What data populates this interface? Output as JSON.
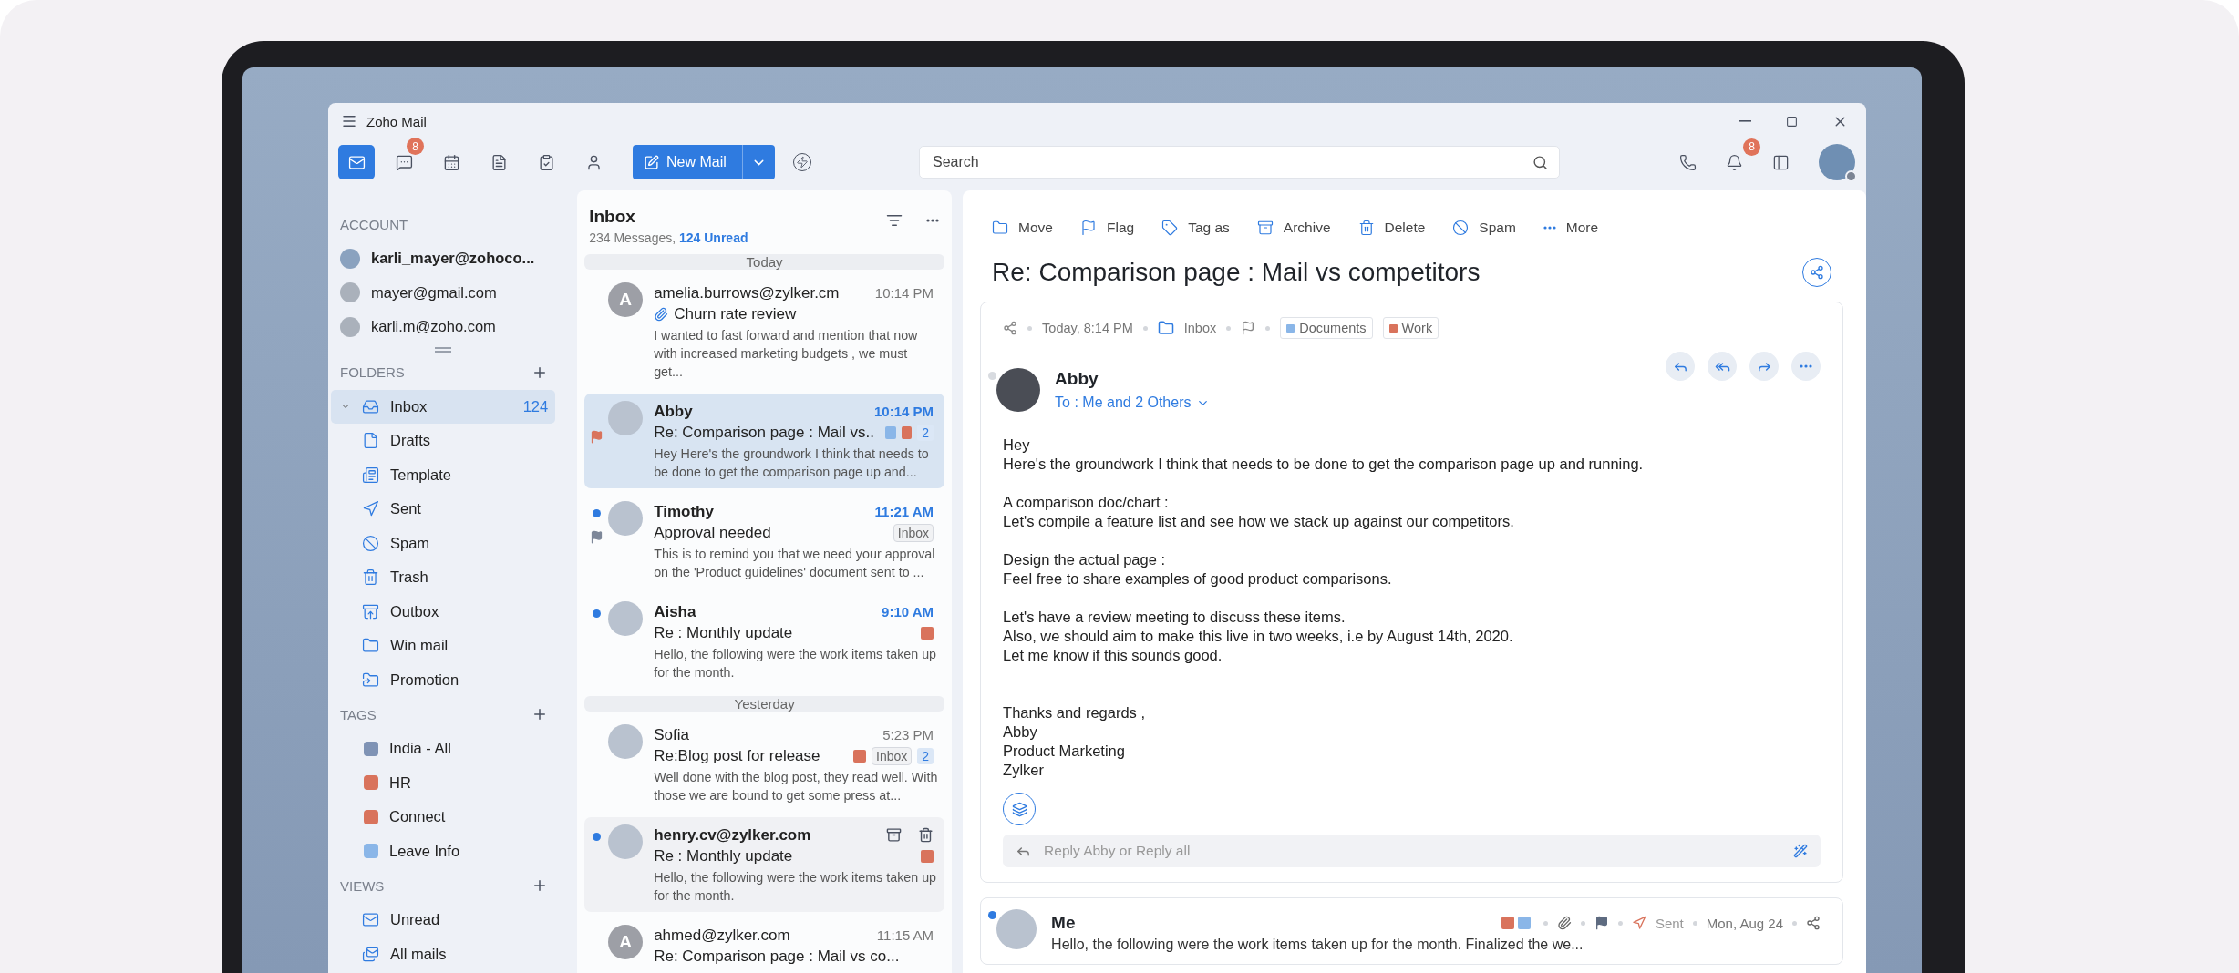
{
  "window": {
    "title": "Zoho Mail"
  },
  "toolbar": {
    "apps": [
      {
        "selected": true
      },
      {
        "selected": false,
        "badge": "8"
      },
      {
        "selected": false
      },
      {
        "selected": false
      },
      {
        "selected": false
      },
      {
        "selected": false
      }
    ],
    "new_mail": "New Mail",
    "search": {
      "placeholder": "Search"
    },
    "notifications_badge": "8"
  },
  "sidebar": {
    "account": {
      "heading": "ACCOUNT",
      "items": [
        {
          "label": "karli_mayer@zohoco...",
          "selected": true
        },
        {
          "label": "mayer@gmail.com",
          "selected": false
        },
        {
          "label": "karli.m@zoho.com",
          "selected": false
        }
      ]
    },
    "folders": {
      "heading": "FOLDERS",
      "items": [
        {
          "label": "Inbox",
          "count": "124",
          "selected": true,
          "collapsible": true
        },
        {
          "label": "Drafts",
          "selected": false,
          "collapsible": false
        },
        {
          "label": "Template",
          "selected": false,
          "collapsible": false
        },
        {
          "label": "Sent",
          "selected": false,
          "collapsible": false
        },
        {
          "label": "Spam",
          "selected": false,
          "collapsible": false
        },
        {
          "label": "Trash",
          "selected": false,
          "collapsible": false
        },
        {
          "label": "Outbox",
          "selected": false,
          "collapsible": false
        },
        {
          "label": "Win mail",
          "selected": false,
          "collapsible": false
        },
        {
          "label": "Promotion",
          "selected": false,
          "collapsible": false
        }
      ]
    },
    "tags": {
      "heading": "TAGS",
      "items": [
        {
          "label": "India - All",
          "color": "#7f93b5"
        },
        {
          "label": "HR",
          "color": "#d9735c"
        },
        {
          "label": "Connect",
          "color": "#d9735c"
        },
        {
          "label": "Leave Info",
          "color": "#8ab6e8"
        }
      ]
    },
    "views": {
      "heading": "VIEWS",
      "items": [
        {
          "label": "Unread"
        },
        {
          "label": "All mails"
        }
      ]
    }
  },
  "list": {
    "title": "Inbox",
    "count_text": "234 Messages,",
    "unread_text": "124 Unread",
    "groups": [
      {
        "heading": "Today",
        "messages": [
          {
            "sender": "amelia.burrows@zylker.cm",
            "time": "10:14 PM",
            "subject": "Churn rate review",
            "preview": "I wanted to fast forward and mention that now with increased marketing budgets , we must get...",
            "avatar": {
              "kind": "letter",
              "letter": "A"
            },
            "unread": false,
            "selected": false,
            "hovered": false,
            "attachment": true
          },
          {
            "sender": "Abby",
            "time": "10:14 PM",
            "subject": "Re: Comparison page : Mail vs..",
            "preview": "Hey  Here's the groundwork I think  that needs to be done to get the comparison page up and...",
            "avatar": {
              "kind": "photo"
            },
            "unread": false,
            "selected": true,
            "hovered": false,
            "attachment": false,
            "flag": {
              "color": "#d9735c"
            },
            "tags": [
              {
                "color": "#8ab6e8"
              },
              {
                "color": "#d9735c"
              }
            ],
            "thread_count": "2"
          },
          {
            "sender": "Timothy",
            "time": "11:21 AM",
            "subject": "Approval needed",
            "preview": "This is to remind you that we need your approval on the 'Product guidelines' document sent to ...",
            "avatar": {
              "kind": "photo"
            },
            "unread": true,
            "selected": false,
            "hovered": false,
            "attachment": false,
            "flag": {
              "color": "#7d8799"
            },
            "folder_badge": "Inbox"
          },
          {
            "sender": "Aisha",
            "time": "9:10 AM",
            "subject": "Re : Monthly update",
            "preview": "Hello, the following were the work items taken up for the month.",
            "avatar": {
              "kind": "photo"
            },
            "unread": true,
            "selected": false,
            "hovered": false,
            "attachment": false,
            "tags": [
              {
                "color": "#d9735c"
              }
            ]
          }
        ]
      },
      {
        "heading": "Yesterday",
        "messages": [
          {
            "sender": "Sofia",
            "time": "5:23 PM",
            "subject": "Re:Blog post for release",
            "preview": "Well done with the blog post, they read well. With those we are bound to get some press at...",
            "avatar": {
              "kind": "photo"
            },
            "unread": false,
            "selected": false,
            "hovered": false,
            "attachment": false,
            "tags": [
              {
                "color": "#d9735c"
              }
            ],
            "folder_badge": "Inbox",
            "thread_count": "2"
          },
          {
            "sender": "henry.cv@zylker.com",
            "subject": "Re : Monthly update",
            "preview": "Hello, the following were the work items taken up for the month.",
            "avatar": {
              "kind": "photo"
            },
            "unread": true,
            "selected": false,
            "hovered": true,
            "attachment": false,
            "tags": [
              {
                "color": "#d9735c"
              }
            ]
          },
          {
            "sender": "ahmed@zylker.com",
            "time": "11:15 AM",
            "subject": "Re: Comparison page : Mail vs co...",
            "avatar": {
              "kind": "letter",
              "letter": "A"
            },
            "unread": false,
            "selected": false,
            "hovered": false,
            "attachment": false
          }
        ]
      }
    ]
  },
  "reader": {
    "actions": [
      "Move",
      "Flag",
      "Tag as",
      "Archive",
      "Delete",
      "Spam",
      "More"
    ],
    "subject": "Re: Comparison page : Mail vs competitors",
    "open_message": {
      "date": "Today, 8:14 PM",
      "folder": "Inbox",
      "tags": [
        {
          "label": "Documents",
          "color": "#8ab6e8"
        },
        {
          "label": "Work",
          "color": "#d9735c"
        }
      ],
      "sender": "Abby",
      "unread": false,
      "recipients": "To : Me and 2 Others",
      "paragraphs": [
        [
          "Hey",
          "Here's the groundwork I think  that needs to be done to get the comparison page up and running."
        ],
        [
          "A comparison doc/chart :",
          "Let's compile a feature list and see how we stack up against our competitors."
        ],
        [
          "Design the actual page :",
          "Feel free to share examples of good product comparisons."
        ],
        [
          "Let's have a review meeting to discuss these items.",
          "Also, we should aim to make this live in two weeks, i.e by August 14th, 2020.",
          "Let me know if this sounds good."
        ]
      ],
      "signature": [
        "Thanks and regards ,",
        "Abby",
        "Product Marketing",
        "Zylker"
      ],
      "reply_placeholder": "Reply Abby or Reply all"
    },
    "next_message": {
      "sender": "Me",
      "unread": true,
      "tags": [
        {
          "color": "#d9735c"
        },
        {
          "color": "#8ab6e8"
        }
      ],
      "status": "Sent",
      "date": "Mon, Aug 24",
      "preview": "Hello, the following were the work items taken up for the month. Finalized the we..."
    }
  }
}
